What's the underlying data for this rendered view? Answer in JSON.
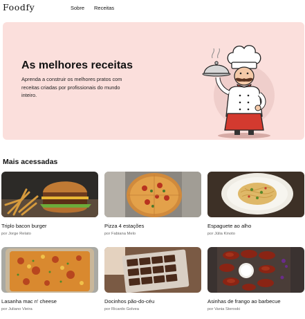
{
  "header": {
    "logo": "Foodfy",
    "nav": {
      "about": "Sobre",
      "recipes": "Receitas"
    }
  },
  "hero": {
    "title": "As melhores receitas",
    "subtitle": "Aprenda a construir os melhores pratos com receitas criadas por profissionais do mundo inteiro."
  },
  "section": {
    "title": "Mais acessadas"
  },
  "recipes": [
    {
      "title": "Triplo bacon burger",
      "author": "por Jorge Relato",
      "image": "burger"
    },
    {
      "title": "Pizza 4 estações",
      "author": "por Fabiana Melo",
      "image": "pizza"
    },
    {
      "title": "Espaguete ao alho",
      "author": "por Júlia Kinoto",
      "image": "spaghetti"
    },
    {
      "title": "Lasanha mac n' cheese",
      "author": "por Juliano Vieira",
      "image": "lasagna"
    },
    {
      "title": "Docinhos pão-do-céu",
      "author": "por Ricardo Golvea",
      "image": "sweets"
    },
    {
      "title": "Asinhas de frango ao barbecue",
      "author": "por Vania Steroski",
      "image": "chicken-wings"
    }
  ]
}
